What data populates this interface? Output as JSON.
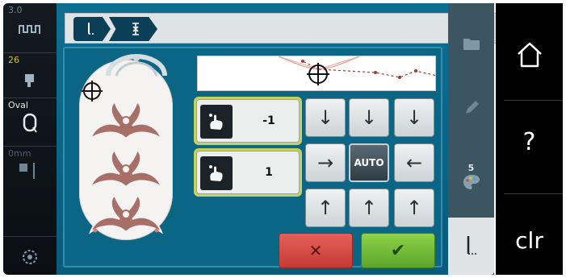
{
  "status_strip": {
    "stitch_width": "3.0",
    "thread_tension": "26",
    "hoop_name": "Oval",
    "needle_position": "0mm"
  },
  "position_fields": [
    {
      "value": "-1"
    },
    {
      "value": "1"
    }
  ],
  "direction_pad": {
    "auto_label": "AUTO"
  },
  "tabs": {
    "colors_count": "5"
  },
  "system": {
    "help_label": "?",
    "clear_label": "clr"
  }
}
